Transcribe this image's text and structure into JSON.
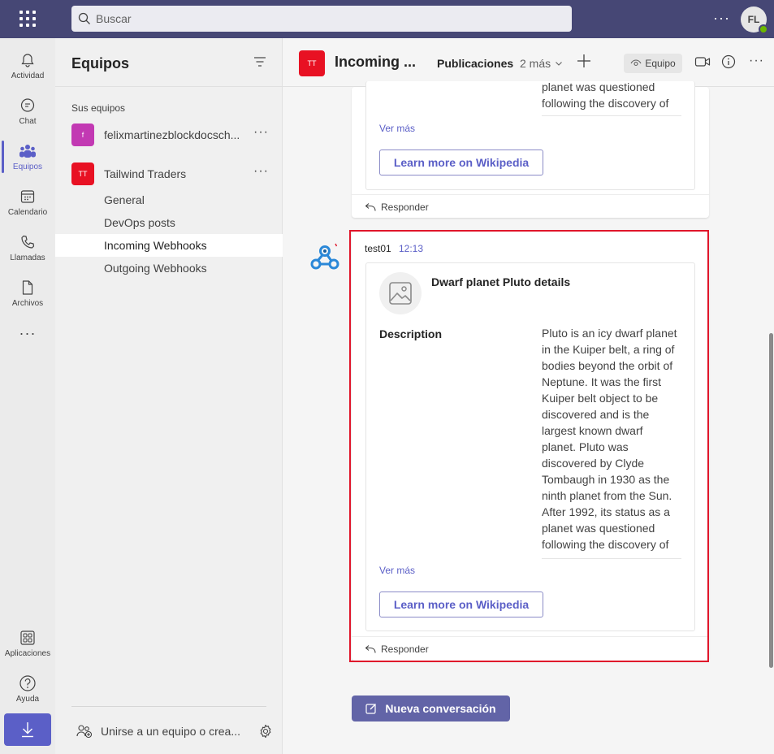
{
  "topbar": {
    "search_placeholder": "Buscar",
    "more": "···",
    "avatar_initials": "FL"
  },
  "rail": {
    "items": [
      {
        "label": "Actividad",
        "icon": "bell-icon"
      },
      {
        "label": "Chat",
        "icon": "chat-icon"
      },
      {
        "label": "Equipos",
        "icon": "teams-icon"
      },
      {
        "label": "Calendario",
        "icon": "calendar-icon"
      },
      {
        "label": "Llamadas",
        "icon": "phone-icon"
      },
      {
        "label": "Archivos",
        "icon": "file-icon"
      }
    ],
    "more": "···",
    "apps_label": "Aplicaciones",
    "help_label": "Ayuda"
  },
  "teams_panel": {
    "title": "Equipos",
    "section_label": "Sus equipos",
    "teams": [
      {
        "badge": "f",
        "name": "felixmartinezblockdocsch...",
        "color": "#c239b3"
      },
      {
        "badge": "TT",
        "name": "Tailwind Traders",
        "color": "#e81123"
      }
    ],
    "channels": [
      "General",
      "DevOps posts",
      "Incoming Webhooks",
      "Outgoing Webhooks"
    ],
    "join_label": "Unirse a un equipo o crea..."
  },
  "channel_header": {
    "badge": "TT",
    "title": "Incoming ...",
    "active_tab": "Publicaciones",
    "more_tabs": "2 más",
    "team_chip": "Equipo"
  },
  "prev_message": {
    "text_lines": [
      "planet was questioned",
      "following the discovery of"
    ],
    "ver_mas": "Ver más",
    "button": "Learn more on Wikipedia",
    "reply": "Responder"
  },
  "message": {
    "sender": "test01",
    "time": "12:13",
    "card_title": "Dwarf planet Pluto details",
    "description_label": "Description",
    "description": "Pluto is an icy dwarf planet in the Kuiper belt, a ring of bodies beyond the orbit of Neptune. It was the first Kuiper belt object to be discovered and is the largest known dwarf planet. Pluto was discovered by Clyde Tombaugh in 1930 as the ninth planet from the Sun. After 1992, its status as a planet was questioned following the discovery of",
    "ver_mas": "Ver más",
    "button": "Learn more on Wikipedia",
    "reply": "Responder"
  },
  "new_conversation": "Nueva conversación",
  "colors": {
    "accent": "#5b5fc7",
    "topbar": "#464775",
    "highlight": "#e0162b"
  }
}
